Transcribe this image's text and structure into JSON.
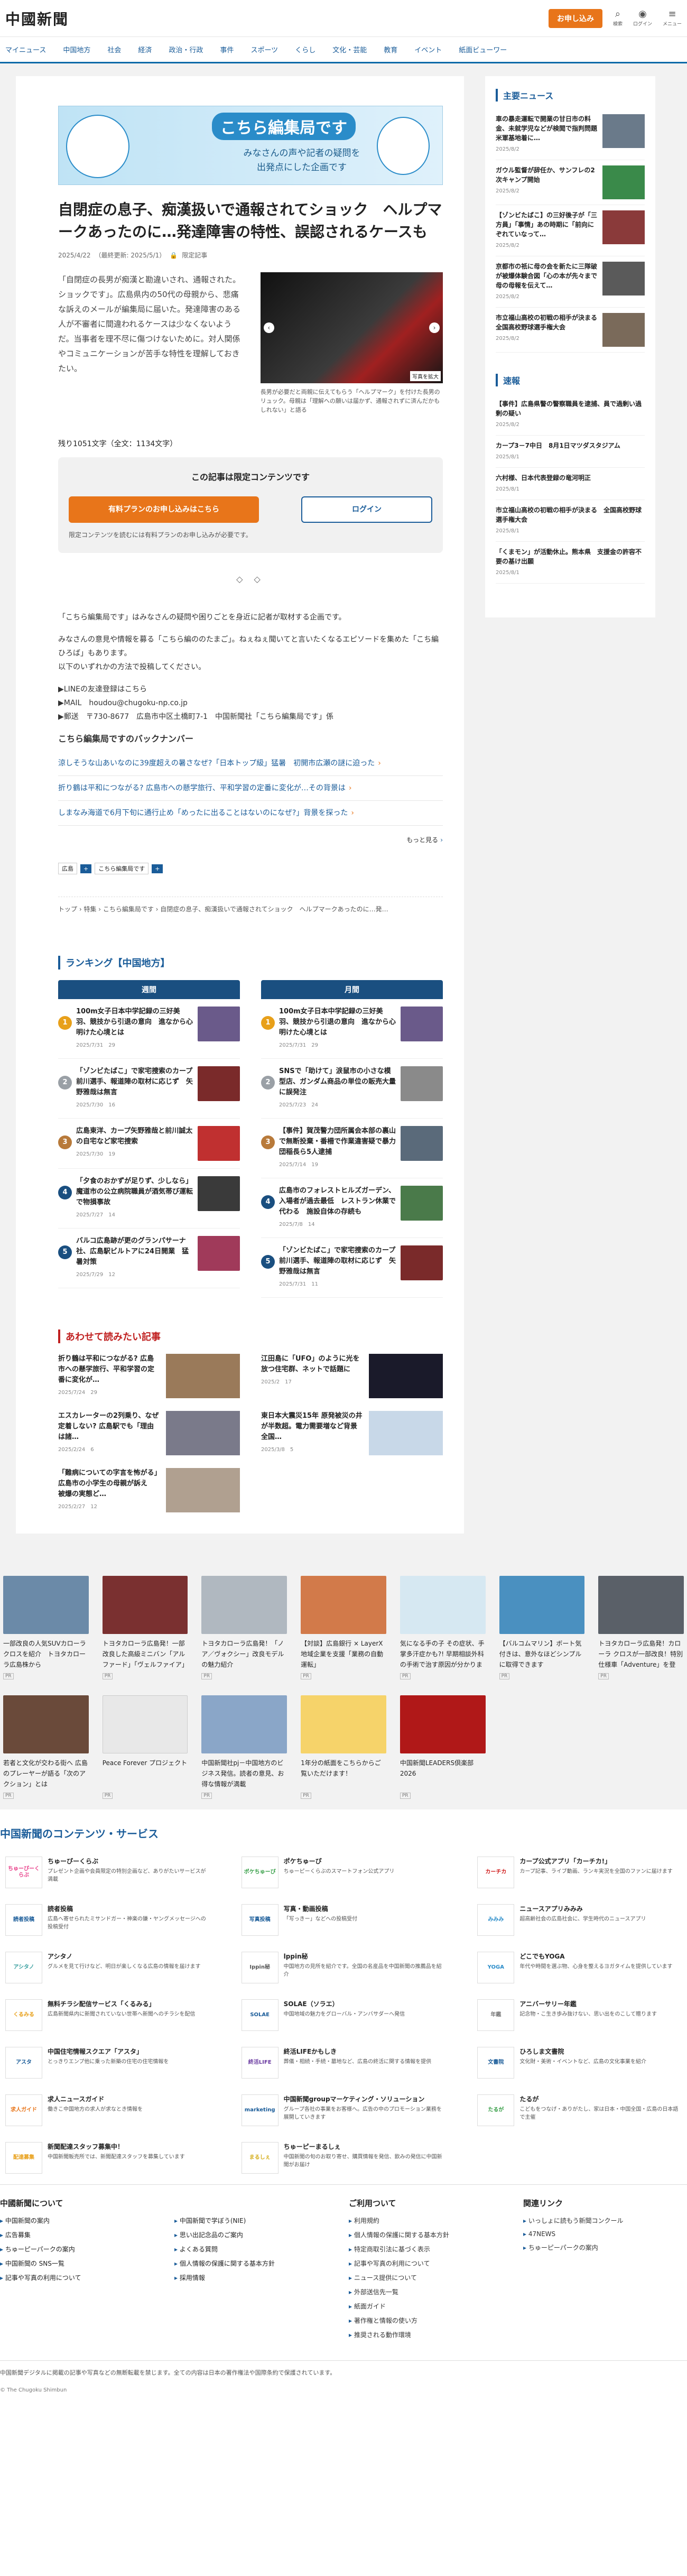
{
  "header": {
    "logo": "中國新聞",
    "signup": "お申し込み",
    "icons": [
      {
        "glyph": "⌕",
        "label": "検索"
      },
      {
        "glyph": "◉",
        "label": "ログイン"
      },
      {
        "glyph": "≡",
        "label": "メニュー"
      }
    ]
  },
  "gnav": [
    "マイニュース",
    "中国地方",
    "社会",
    "経済",
    "政治・行政",
    "事件",
    "スポーツ",
    "くらし",
    "文化・芸能",
    "教育",
    "イベント",
    "紙面ビューワー"
  ],
  "banner": {
    "title": "こちら編集局です",
    "line1": "みなさんの声や記者の疑問を",
    "line2": "出発点にした企画です"
  },
  "article": {
    "title": "自閉症の息子、痴漢扱いで通報されてショック　ヘルプマークあったのに…発達障害の特性、誤認されるケースも",
    "date": "2025/4/22",
    "updated": "（最終更新: 2025/5/1）",
    "badge": "限定記事",
    "lead": "「自閉症の長男が痴漢と勘違いされ、通報された。ショックです」。広島県内の50代の母親から、悲痛な訴えのメールが編集局に届いた。発達障害のある人が不審者に間違われるケースは少なくないようだ。当事者を理不尽に傷つけないために。対人関係やコミュニケーションが苦手な特性を理解しておきたい。",
    "photo_tag": "写真を拡大",
    "caption": "長男が必要だと両親に伝えてもらう「ヘルプマーク」を付けた長男のリュック。母親は「理解への願いは届かず、通報されずに済んだかもしれない」と語る",
    "chars": "残り1051文字（全文：1134文字）",
    "paywall_head": "この記事は限定コンテンツです",
    "plan_btn": "有料プランのお申し込みはこちら",
    "login_btn": "ログイン",
    "paywall_note": "限定コンテンツを読むには有料プランのお申し込みが必要です。",
    "dots": "◇ ◇"
  },
  "body": {
    "p1": "「こちら編集局です」はみなさんの疑問や困りごとを身近に記者が取材する企画です。",
    "p2": "みなさんの意見や情報を募る「こちら編ののたまご」。ねぇねぇ聞いてと言いたくなるエピソードを集めた「こち編ひろば」もあります。",
    "p3": "以下のいずれかの方法で投稿してください。",
    "c1": "▶LINEの友達登録はこちら",
    "c2": "▶MAIL　houdou@chugoku-np.co.jp",
    "c3": "▶郵送　〒730-8677　広島市中区土橋町7-1　中国新聞社「こちら編集局です」係",
    "backnum": "こちら編集局ですのバックナンバー",
    "links": [
      "涼しそうな山あいなのに39度超えの暑さなぜ?「日本トップ級」猛暑　初開市広瀬の謎に迫った",
      "折り鶴は平和につながる? 広島市への懸学旅行、平和学習の定番に変化が…その背景は",
      "しまなみ海道で6月下旬に通行止め「めったに出ることはないのになぜ?」背景を探った"
    ],
    "more": "もっと見る",
    "tag_pill": "広島",
    "tag_label": "こちら編集局です",
    "crumb": "トップ › 特集 › こちら編集局です › 自閉症の息子、痴漢扱いで通報されてショック　ヘルプマークあったのに…発…"
  },
  "ranking": {
    "title": "ランキング【中国地方】",
    "cols": [
      {
        "head": "週間",
        "items": [
          {
            "t": "100m女子日本中学記録の三好美羽、競技から引退の意向　進なから心明けた心境とは",
            "m": "2025/7/31　29",
            "c": "#1a4f80"
          },
          {
            "t": "「ゾンビたばこ」で家宅捜索のカープ前川選手、報道陣の取材に応じず　矢野雅哉は無言",
            "m": "2025/7/30　16",
            "c": "#1a4f80"
          },
          {
            "t": "広島東洋、カープ矢野雅哉と前川誠太の自宅など家宅捜索",
            "m": "2025/7/30　19",
            "c": "#1a4f80"
          },
          {
            "t": "「夕食のおかずが足りず、少しなら」魔道市の公立病院職員が酒気帯び運転で物損事故",
            "m": "2025/7/27　14",
            "c": "#1a4f80"
          },
          {
            "t": "バルコ広島跡が更のグランパサーナ社、広島駅ビルトアに24日開業　猛暑対策",
            "m": "2025/7/29　12",
            "c": "#1a4f80"
          }
        ]
      },
      {
        "head": "月間",
        "items": [
          {
            "t": "100m女子日本中学記録の三好美羽、競技から引退の意向　進なから心明けた心境とは",
            "m": "2025/7/31　29",
            "c": "#e8a01a"
          },
          {
            "t": "SNSで「助けて」涙鼠市の小さな模型店、ガンダム商品の単位の販売大量に誤発注",
            "m": "2025/7/23　24",
            "c": "#1a4f80"
          },
          {
            "t": "【事件】賀茂警力団所属会本部の裏山で無断投棄・番柵で作業違害疑で暴力団稲長ら5人逮捕",
            "m": "2025/7/14　19",
            "c": "#1a4f80"
          },
          {
            "t": "広島市のフォレストヒルズガーデン、入場者が過去最低　レストラン休業で代わる　施設自体の存続も",
            "m": "2025/7/8　14",
            "c": "#1a4f80"
          },
          {
            "t": "「ゾンビたばこ」で家宅捜索のカープ前川選手、報道陣の取材に応じず　矢野雅哉は無言",
            "m": "2025/7/31　11",
            "c": "#1a4f80"
          }
        ]
      }
    ]
  },
  "also": {
    "title": "あわせて読みたい記事",
    "items": [
      {
        "t": "折り鶴は平和につながる? 広島市への懸学旅行、平和学習の定番に変化が…",
        "m": "2025/7/24　29"
      },
      {
        "t": "江田島に「UFO」のように光を放つ住宅群、ネットで話題に",
        "m": "2025/2　17"
      },
      {
        "t": "エスカレーターの2列乗り、なぜ定着しない? 広島駅でも「理由は諸…",
        "m": "2025/2/24　6"
      },
      {
        "t": "東日本大震災15年 原発被災の井が半数超。電力需要増など背景　全国…",
        "m": "2025/3/8　5"
      },
      {
        "t": "「難病についての字言を怖がる」広島市の小学生の母親が訴え　被爆の実態ど…",
        "m": "2025/2/27　12"
      }
    ]
  },
  "side": {
    "main_title": "主要ニュース",
    "main": [
      {
        "t": "車の暴走運転で開業の甘日市の料金、未就学児などが検閲で指判問題　米軍基地着に…",
        "m": "2025/8/2"
      },
      {
        "t": "ガウル監督が辞任か、サンフレの2次キャンプ開始",
        "m": "2025/8/2"
      },
      {
        "t": "【ゾンビたばこ】の三好後子が「三方員」「事情」あの時期に「前向にぞれていなって…",
        "m": "2025/8/2"
      },
      {
        "t": "京都市の祇に母の会を新たに三隊破が被爆体験合図「心の本が先々まで母の母報を伝えて…",
        "m": "2025/8/2"
      },
      {
        "t": "市立福山高校の初戦の相手が決まる　全国高校野球選手権大会",
        "m": "2025/8/2"
      }
    ],
    "flash_title": "速報",
    "flash": [
      {
        "t": "【事件】広島県警の警察職員を逮捕、員で過剰い過剰の疑い",
        "m": "2025/8/2"
      },
      {
        "t": "カープ3－7中日　8月1日マツダスタジアム",
        "m": "2025/8/1"
      },
      {
        "t": "六村様、日本代表登録の竜河明正",
        "m": "2025/8/1"
      },
      {
        "t": "市立福山高校の初戦の相手が決まる　全国高校野球選手権大会",
        "m": "2025/8/1"
      },
      {
        "t": "「くまモン」が活動休止。熊本県　支援金の許容不要の基け出願",
        "m": "2025/8/1"
      }
    ]
  },
  "ads": [
    {
      "t": "一部改良の人気SUVカローラクロスを紹介　トヨタカローラ広島株から",
      "c": "#6b8aa8"
    },
    {
      "t": "トヨタカローラ広島発！一部改良した高級ミニバン「アルファード」「ヴェルファイア」の魅力",
      "c": "#7a3030"
    },
    {
      "t": "トヨタカローラ広島発！「ノア／ヴォクシー」改良モデルの魅力紹介",
      "c": "#b0b8c0"
    },
    {
      "t": "【対談】広島銀行 × LayerX 地域企業を支援「業務の自動運転」",
      "c": "#d27a4a"
    },
    {
      "t": "気になる手の子 その症状、手掌多汗症かも?! 早期相談外科の手術で治す原因が分かります",
      "c": "#d6e8f2"
    },
    {
      "t": "【バルコムマリン】ボート気付きは、意外なほどシンプルに取得できます",
      "c": "#4a90c0"
    },
    {
      "t": "トヨタカローラ広島発！カローラ クロスが一部改良！特別仕様車「Adventure」を登場！",
      "c": "#5a6068"
    },
    {
      "t": "若者と文化が交わる街へ 広島のプレーヤーが語る「次のアクション」とは",
      "c": "#6a4a3a"
    },
    {
      "t": "Peace Forever プロジェクト",
      "c": "#f2f2f2"
    },
    {
      "t": "中国新聞社pj－中国地方のビジネス発信。読者の意見、お得な情報が満載",
      "c": "#8aa6c8"
    },
    {
      "t": "1年分の紙面をこちらからご覧いただけます！",
      "c": "#f6d36a"
    },
    {
      "t": "中国新聞LEADERS倶楽部2026",
      "c": "#b01818"
    }
  ],
  "contents": {
    "title": "中国新聞のコンテンツ・サービス",
    "items": [
      {
        "n": "ちゅーぴーくらぶ",
        "d": "プレゼント企画や会員限定の特別企画など、ありがたいサービスが満載",
        "l": "ちゅーぴーくらぶ",
        "c": "#e8408a"
      },
      {
        "n": "ポケちゅーぴ",
        "d": "ちゅーピーくらぶのスマートフォン公式アプリ",
        "l": "ポケちゅーぴ",
        "c": "#3aa04a"
      },
      {
        "n": "カープ公式アプリ「カーチカ!」",
        "d": "カープ記事、ライブ動画、ランキ実況を全国のファンに届けます",
        "l": "カーチカ",
        "c": "#d02020"
      },
      {
        "n": "読者投稿",
        "d": "広島へ寄せられたミサンドガー・神楽の鎌・ヤングメッセージへの投稿受付",
        "l": "読者投稿",
        "c": "#1a5c99"
      },
      {
        "n": "写真・動画投稿",
        "d": "「写っきー」などへの投稿受付",
        "l": "写真投稿",
        "c": "#1a5c99"
      },
      {
        "n": "ニュースアプリみみみ",
        "d": "超高齢社会の広島社会に、学生時代のニュースアプリ",
        "l": "みみみ",
        "c": "#2a8cc9"
      },
      {
        "n": "アシタノ",
        "d": "グルメを見て行けなど、明日が楽しくなる広島の情報を届けます",
        "l": "アシタノ",
        "c": "#3aa0a0"
      },
      {
        "n": "lppin秘",
        "d": "中国地方の見所を紹介です。全国の名産品を中国新聞の推薦品を紹介",
        "l": "Ippin秘",
        "c": "#555"
      },
      {
        "n": "どこでもYOGA",
        "d": "年代や時間を選ぶ物、心身を整えるヨガタイムを提供しています",
        "l": "YOGA",
        "c": "#2a8cc9"
      },
      {
        "n": "無料チラシ配信サービス「くるみる」",
        "d": "広島新聞県内に新聞されていない世帯へ新聞へのチラシを配信",
        "l": "くるみる",
        "c": "#e8a01a"
      },
      {
        "n": "SOLAE（ソラエ）",
        "d": "中国地域の魅力をグローバル・アンバサダーへ発信",
        "l": "SOLAE",
        "c": "#1a5c99"
      },
      {
        "n": "アニバーサリー年鑑",
        "d": "記念物・こ生き歩み抜けない、思い出をのこして贈ります",
        "l": "年鑑",
        "c": "#777"
      },
      {
        "n": "中国住宅情報スクエア「アスタ」",
        "d": "とっきりエンプ他に乗った新築の住宅の住宅情報を",
        "l": "アスタ",
        "c": "#1a5c99"
      },
      {
        "n": "終活LIFEかもしき",
        "d": "葬儀・相続・手続・墓地など、広島の終活に関する情報を提供",
        "l": "終活LIFE",
        "c": "#6a3aa0"
      },
      {
        "n": "ひろしま文書院",
        "d": "文化財・美術・イベントなど、広島の文化事業を紹介",
        "l": "文書院",
        "c": "#1a5c99"
      },
      {
        "n": "求人ニュースガイド",
        "d": "働きこ中国地方の求人が求なとき情報を",
        "l": "求人ガイド",
        "c": "#e8751a"
      },
      {
        "n": "中国新聞groupマーケティング・ソリューション",
        "d": "グループ各社の事業をお客様へ。広告の中のプロモーション業務を展開していきます",
        "l": "marketing",
        "c": "#1a5c99"
      },
      {
        "n": "たるが",
        "d": "こどもをつなげ・ありがたし、家は日本・中国全国・広島の日本語で主催",
        "l": "たるが",
        "c": "#3aa04a"
      },
      {
        "n": "新聞配達スタッフ募集中！",
        "d": "中国新聞販売所では、新聞配達スタッフを募集しています",
        "l": "配達募集",
        "c": "#e8a01a"
      },
      {
        "n": "ちゅーピーまるしぇ",
        "d": "中国新聞の旬のお取り寄せ、購買情報を発信、飲みの発信に中国新聞がお届け",
        "l": "まるしぇ",
        "c": "#d6b020"
      }
    ]
  },
  "footer": {
    "about_h": "中國新聞について",
    "about": [
      "中国新聞の案内",
      "中国新聞で学ぼう(NIE)",
      "広告募集",
      "思い出記念品のご案内",
      "ちゅーピーパークの案内",
      "よくある質問",
      "中国新聞の SNS一覧",
      "個人情報の保護に関する基本方針",
      "記事や写真の利用について",
      "採用情報"
    ],
    "use_h": "ご利用ついて",
    "use": [
      "利用規約",
      "個人情報の保護に関する基本方針",
      "特定商取引法に基づく表示",
      "記事や写真の利用について",
      "ニュース提供について",
      "外部送信先一覧",
      "紙面ガイド",
      "著作権と情報の使い方",
      "推奨される動作環境"
    ],
    "rel_h": "関連リンク",
    "rel": [
      "いっしょに読もう新聞コンクール",
      "47NEWS",
      "ちゅーピーパークの案内"
    ]
  },
  "copy": "中国新聞デジタルに掲載の記事や写真などの無断転載を禁じます。全ての内容は日本の著作権法や国際条約で保護されています。",
  "copy2": "© The Chugoku Shimbun"
}
